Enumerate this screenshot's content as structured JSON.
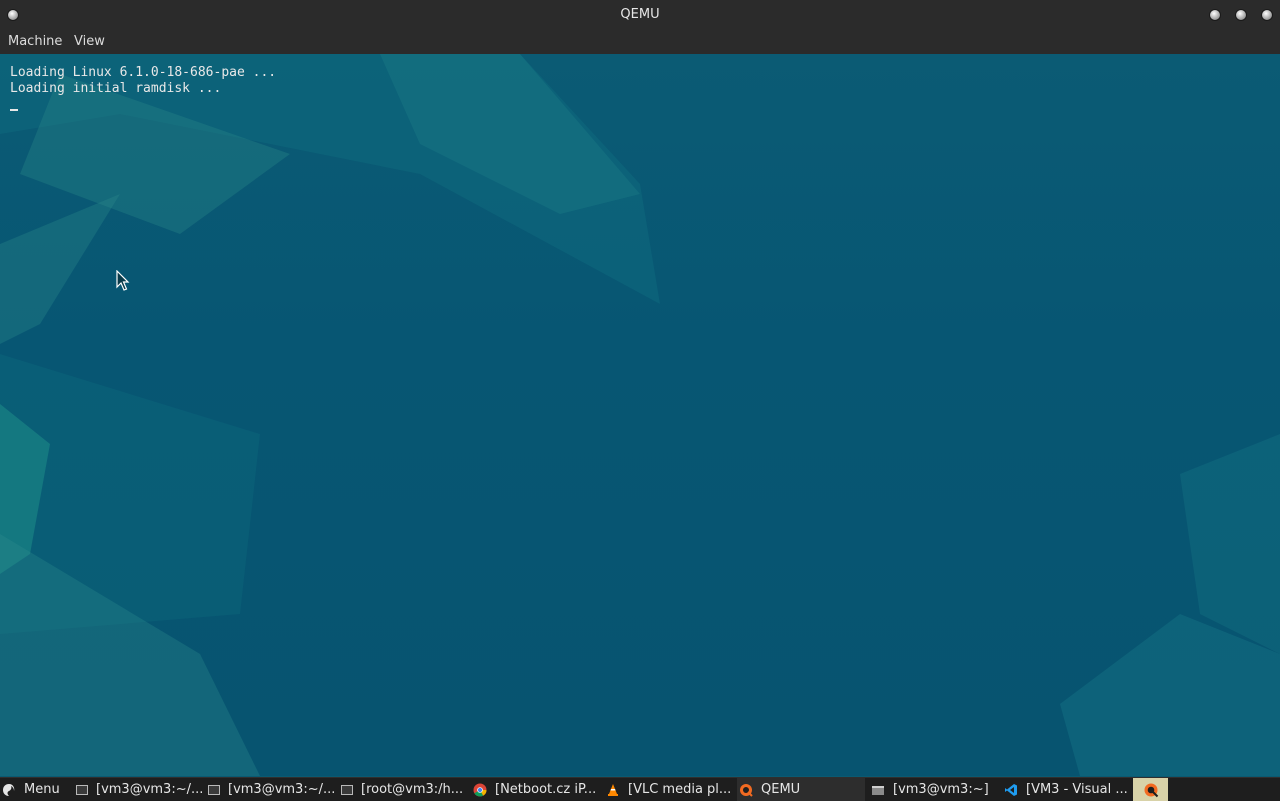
{
  "window": {
    "title": "QEMU",
    "menu": [
      "Machine",
      "View"
    ]
  },
  "console": {
    "lines": [
      "Loading Linux 6.1.0-18-686-pae ...",
      "Loading initial ramdisk ..."
    ]
  },
  "taskbar": {
    "menu_label": "Menu",
    "items": [
      {
        "label": "[vm3@vm3:~/...",
        "icon": "terminal-icon"
      },
      {
        "label": "[vm3@vm3:~/...",
        "icon": "terminal-icon"
      },
      {
        "label": "[root@vm3:/h...",
        "icon": "terminal-icon"
      },
      {
        "label": "[Netboot.cz iP...",
        "icon": "chrome-icon"
      },
      {
        "label": "[VLC media pl...",
        "icon": "vlc-icon"
      },
      {
        "label": "QEMU",
        "icon": "qemu-icon"
      },
      {
        "label": "[vm3@vm3:~]",
        "icon": "window-icon"
      },
      {
        "label": "[VM3 - Visual ...",
        "icon": "vscode-icon"
      }
    ]
  },
  "colors": {
    "desktop_bg": "#0a5a72",
    "titlebar_bg": "#2b2b2b",
    "taskbar_bg": "#1e1e1e"
  }
}
